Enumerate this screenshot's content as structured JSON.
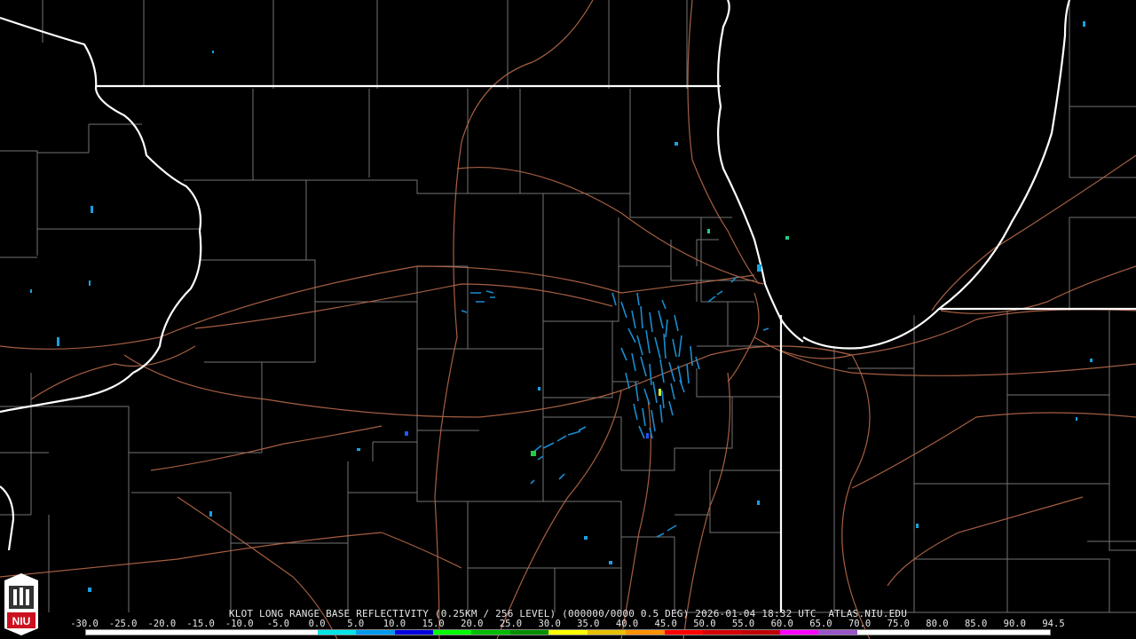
{
  "product": {
    "title": "KLOT LONG RANGE BASE REFLECTIVITY (0.25KM / 256 LEVEL) (000000/0000 0.5 DEG) 2026-01-04 18:32 UTC  ATLAS.NIU.EDU"
  },
  "logo": {
    "text": "NIU",
    "icon": "niu-logo-icon"
  },
  "scale": {
    "labels": [
      "-30.0",
      "-25.0",
      "-20.0",
      "-15.0",
      "-10.0",
      "-5.0",
      "0.0",
      "5.0",
      "10.0",
      "15.0",
      "20.0",
      "25.0",
      "30.0",
      "35.0",
      "40.0",
      "45.0",
      "50.0",
      "55.0",
      "60.0",
      "65.0",
      "70.0",
      "75.0",
      "80.0",
      "85.0",
      "90.0",
      "94.5"
    ],
    "colors": [
      "#ffffff",
      "#ffffff",
      "#ffffff",
      "#ffffff",
      "#ffffff",
      "#ffffff",
      "#00e5e5",
      "#0099ee",
      "#0000dd",
      "#00ff00",
      "#00bb00",
      "#009000",
      "#ffff00",
      "#e7c000",
      "#ff9000",
      "#ff0000",
      "#d60000",
      "#c00000",
      "#ff00ff",
      "#9955c9",
      "#ffffff",
      "#ffffff",
      "#ffffff",
      "#ffffff",
      "#ffffff"
    ]
  }
}
